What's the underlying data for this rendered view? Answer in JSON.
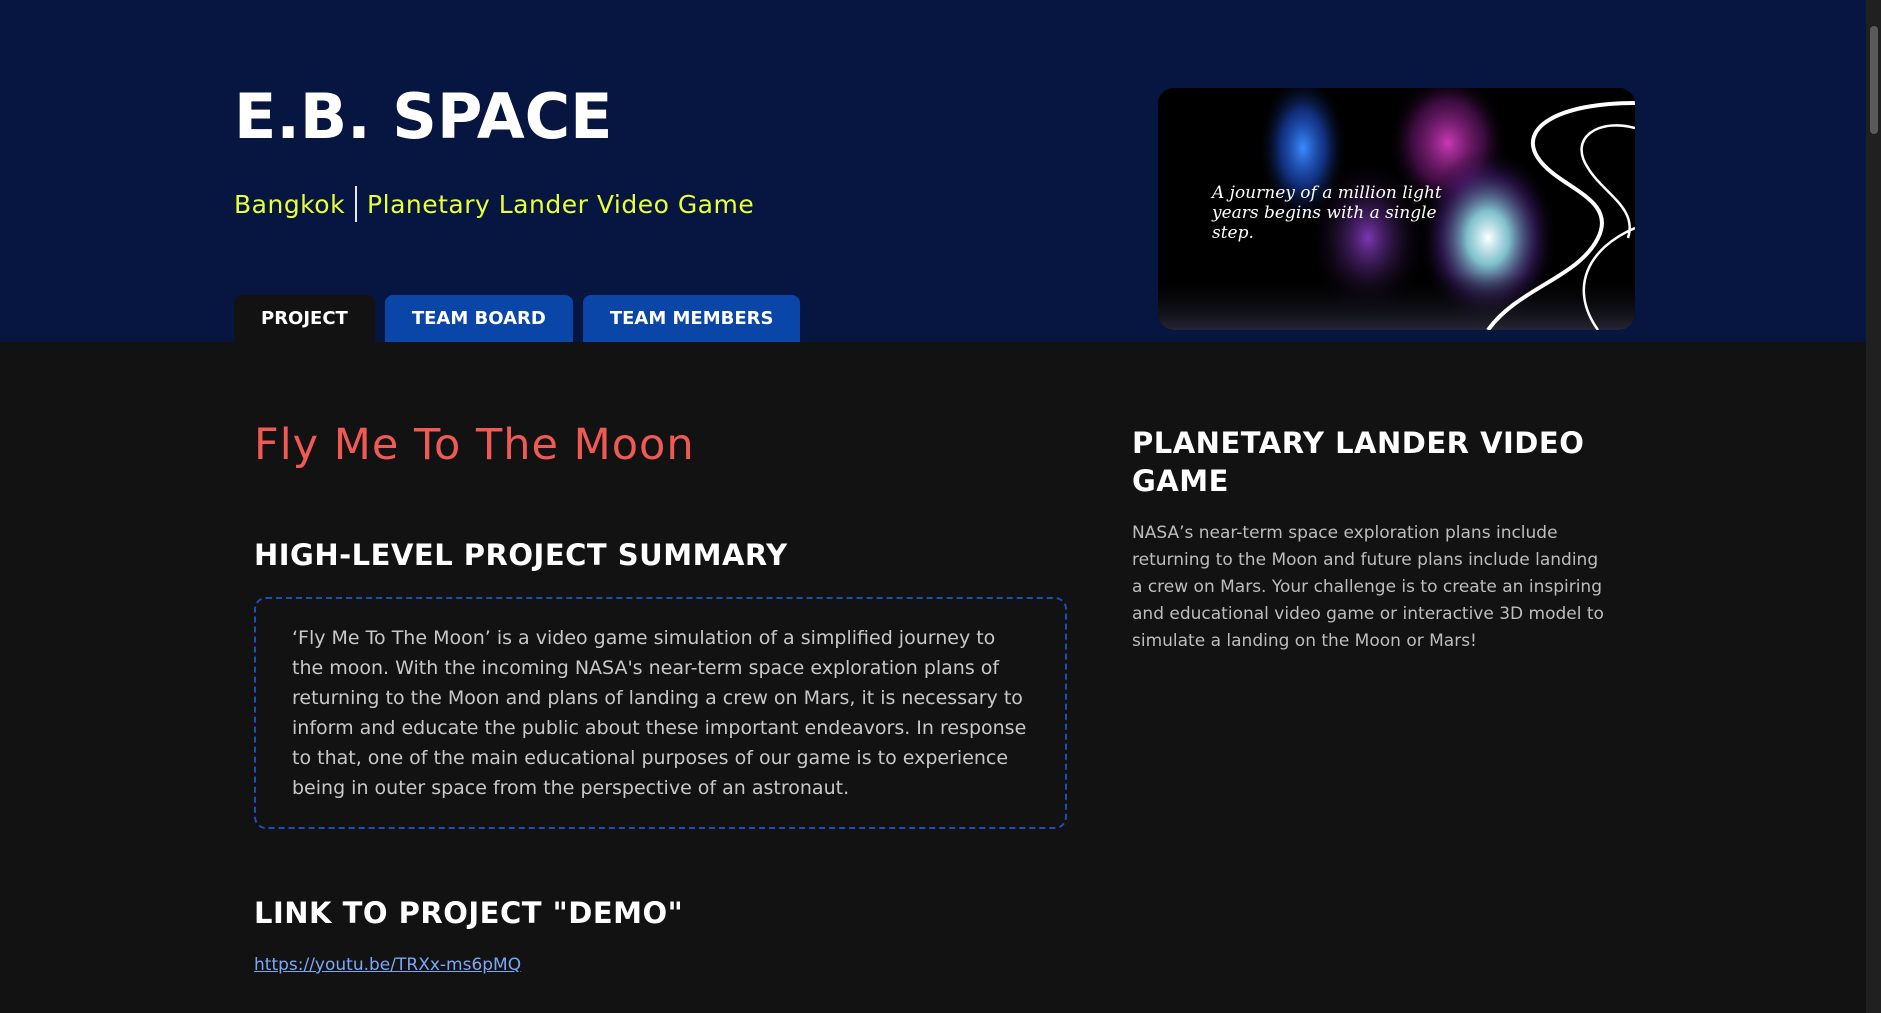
{
  "header": {
    "team_name": "E.B. SPACE",
    "location": "Bangkok",
    "challenge": "Planetary Lander Video Game",
    "tabs": [
      {
        "label": "PROJECT",
        "active": true
      },
      {
        "label": "TEAM BOARD",
        "active": false
      },
      {
        "label": "TEAM MEMBERS",
        "active": false
      }
    ],
    "image_quote": "A journey of a million light years begins with a single step."
  },
  "project": {
    "title": "Fly Me To The Moon",
    "summary_heading": "HIGH-LEVEL PROJECT SUMMARY",
    "summary": "‘Fly Me To The Moon’ is a video game simulation of a simplified journey to the moon. With the incoming NASA's near-term space exploration plans of returning to the Moon and plans of landing a crew on Mars, it is necessary to inform and educate the public about these important endeavors. In response to that, one of the main educational purposes of our game is to experience being in outer space from the perspective of an astronaut.",
    "demo_heading": "LINK TO PROJECT \"DEMO\"",
    "demo_link": "https://youtu.be/TRXx-ms6pMQ"
  },
  "challenge_info": {
    "title": "PLANETARY LANDER VIDEO GAME",
    "description": "NASA’s near-term space exploration plans include returning to the Moon and future plans include landing a crew on Mars. Your challenge is to create an inspiring and educational video game or interactive 3D model to simulate a landing on the Moon or Mars!"
  },
  "colors": {
    "header_bg": "#061640",
    "page_bg": "#121212",
    "tab_blue": "#0a45a8",
    "location_yellow": "#e8ff3a",
    "title_red": "#f15a54",
    "link_blue": "#7da7f5",
    "dashed_border": "#1e4fb8"
  }
}
